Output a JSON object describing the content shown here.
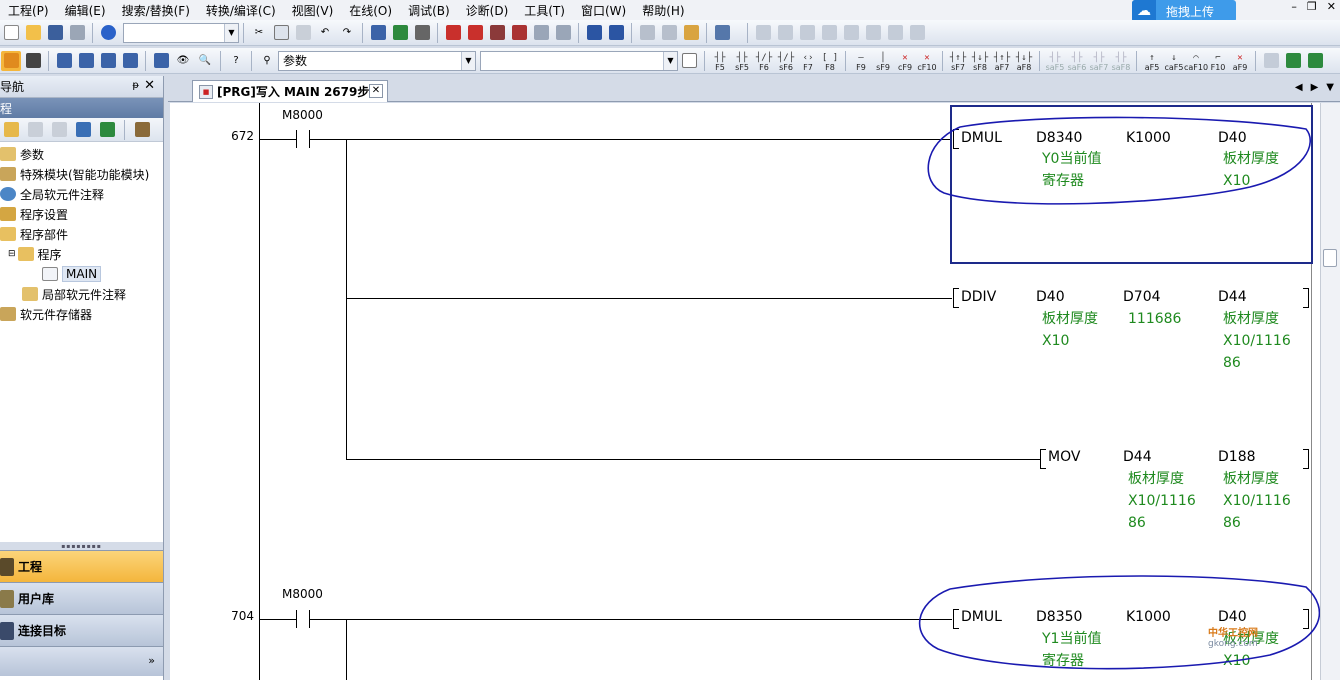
{
  "menubar": {
    "items": [
      "工程(P)",
      "编辑(E)",
      "搜索/替换(F)",
      "转换/编译(C)",
      "视图(V)",
      "在线(O)",
      "调试(B)",
      "诊断(D)",
      "工具(T)",
      "窗口(W)",
      "帮助(H)"
    ],
    "upload_label": "拖拽上传"
  },
  "toolbar2": {
    "combo1_value": "参数",
    "fkeys": [
      "F5",
      "sF5",
      "F6",
      "sF6",
      "F7",
      "F8",
      "F9",
      "sF9",
      "cF9",
      "cF10",
      "sF7",
      "sF8",
      "aF7",
      "aF8",
      "saF5",
      "saF6",
      "saF7",
      "saF8",
      "aF5",
      "caF5",
      "caF10",
      "F10",
      "aF9"
    ]
  },
  "nav": {
    "title": "导航",
    "section": "程",
    "tree": [
      {
        "label": "参数"
      },
      {
        "label": "特殊模块(智能功能模块)"
      },
      {
        "label": "全局软元件注释"
      },
      {
        "label": "程序设置"
      },
      {
        "label": "程序部件"
      },
      {
        "label": "程序"
      },
      {
        "label": "MAIN"
      },
      {
        "label": "局部软元件注释"
      },
      {
        "label": "软元件存储器"
      }
    ],
    "bottom": [
      {
        "label": "工程"
      },
      {
        "label": "用户库"
      },
      {
        "label": "连接目标"
      }
    ]
  },
  "tab": {
    "label": "[PRG]写入 MAIN 2679步"
  },
  "ladder": {
    "rungs": [
      {
        "step": "672",
        "contact": "M8000",
        "instructions": [
          {
            "op": "DMUL",
            "args": [
              "D8340",
              "K1000",
              "D40"
            ],
            "comments": [
              [
                "Y0当前值",
                "寄存器"
              ],
              [],
              [
                "板材厚度",
                "X10"
              ]
            ]
          },
          {
            "op": "DDIV",
            "args": [
              "D40",
              "D704",
              "D44"
            ],
            "comments": [
              [
                "板材厚度",
                "X10"
              ],
              [
                "111686"
              ],
              [
                "板材厚度",
                "X10/1116",
                "86"
              ]
            ]
          },
          {
            "op": "MOV",
            "args": [
              "D44",
              "D188"
            ],
            "comments": [
              [
                "板材厚度",
                "X10/1116",
                "86"
              ],
              [
                "板材厚度",
                "X10/1116",
                "86"
              ]
            ]
          }
        ]
      },
      {
        "step": "704",
        "contact": "M8000",
        "instructions": [
          {
            "op": "DMUL",
            "args": [
              "D8350",
              "K1000",
              "D40"
            ],
            "comments": [
              [
                "Y1当前值",
                "寄存器"
              ],
              [],
              [
                "板材厚度",
                "X10"
              ]
            ]
          }
        ]
      }
    ]
  },
  "watermark": {
    "main": "中华工控网",
    "sub": "gkong.com"
  },
  "colors": {
    "comment_green": "#1f8a1f",
    "selection_box": "#1d2a8a",
    "annotation_circle": "#1a1ab0",
    "nav_active": "#f4b63c"
  }
}
